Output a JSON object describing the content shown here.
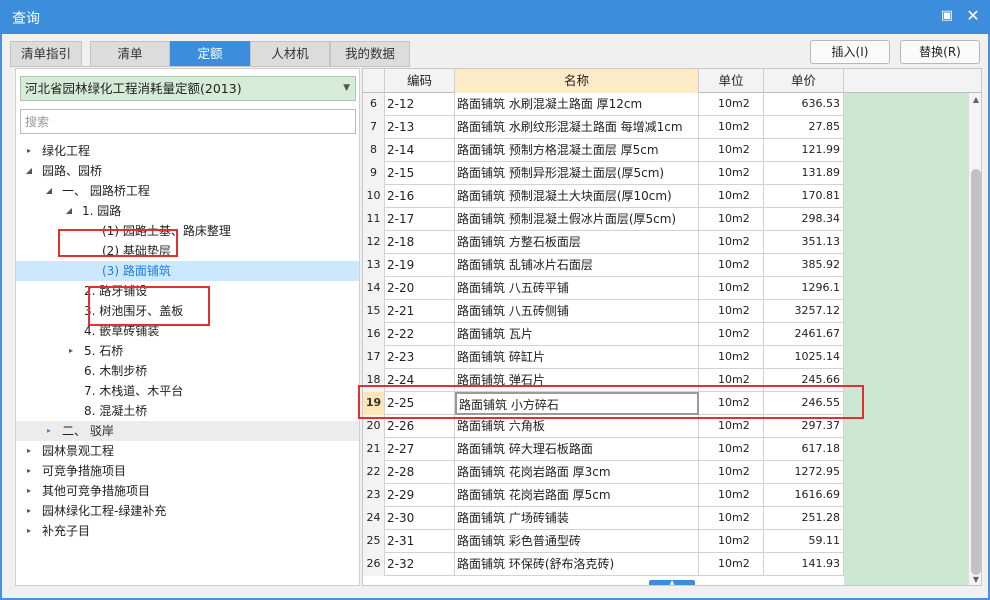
{
  "window": {
    "title": "查询",
    "maximize_icon": "maximize-icon",
    "close_icon": "close-icon"
  },
  "tabs": [
    {
      "label": "清单指引",
      "active": false
    },
    {
      "label": "清单",
      "active": false
    },
    {
      "label": "定额",
      "active": true
    },
    {
      "label": "人材机",
      "active": false
    },
    {
      "label": "我的数据",
      "active": false
    }
  ],
  "toolbar": {
    "insert_label": "插入(I)",
    "replace_label": "替换(R)"
  },
  "library": {
    "selected": "河北省园林绿化工程消耗量定额(2013)"
  },
  "search": {
    "placeholder": "搜索"
  },
  "tree": [
    {
      "label": "绿化工程",
      "expander": "▸"
    },
    {
      "label": "园路、园桥",
      "expander": "◢"
    },
    {
      "label": "一、 园路桥工程",
      "expander": "◢"
    },
    {
      "label": "1. 园路",
      "expander": "◢"
    },
    {
      "label": "(1) 园路土基、路床整理",
      "expander": ""
    },
    {
      "label": "(2) 基础垫层",
      "expander": ""
    },
    {
      "label": "(3) 路面铺筑",
      "expander": ""
    },
    {
      "label": "2. 路牙铺设",
      "expander": ""
    },
    {
      "label": "3. 树池围牙、盖板",
      "expander": ""
    },
    {
      "label": "4. 嵌草砖铺装",
      "expander": ""
    },
    {
      "label": "5. 石桥",
      "expander": "▸"
    },
    {
      "label": "6. 木制步桥",
      "expander": ""
    },
    {
      "label": "7. 木栈道、木平台",
      "expander": ""
    },
    {
      "label": "8. 混凝土桥",
      "expander": ""
    },
    {
      "label": "二、 驳岸",
      "expander": "▸"
    },
    {
      "label": "园林景观工程",
      "expander": "▸"
    },
    {
      "label": "可竞争措施项目",
      "expander": "▸"
    },
    {
      "label": "其他可竞争措施项目",
      "expander": "▸"
    },
    {
      "label": "园林绿化工程-绿建补充",
      "expander": "▸"
    },
    {
      "label": "补充子目",
      "expander": "▸"
    }
  ],
  "grid": {
    "headers": {
      "code": "编码",
      "name": "名称",
      "unit": "单位",
      "price": "单价"
    },
    "rows": [
      {
        "no": "6",
        "code": "2-12",
        "name": "路面铺筑 水刷混凝土路面 厚12cm",
        "unit": "10m2",
        "price": "636.53"
      },
      {
        "no": "7",
        "code": "2-13",
        "name": "路面铺筑 水刷纹形混凝土路面 每增减1cm",
        "unit": "10m2",
        "price": "27.85"
      },
      {
        "no": "8",
        "code": "2-14",
        "name": "路面铺筑 预制方格混凝土面层 厚5cm",
        "unit": "10m2",
        "price": "121.99"
      },
      {
        "no": "9",
        "code": "2-15",
        "name": "路面铺筑 预制异形混凝土面层(厚5cm)",
        "unit": "10m2",
        "price": "131.89"
      },
      {
        "no": "10",
        "code": "2-16",
        "name": "路面铺筑 预制混凝土大块面层(厚10cm)",
        "unit": "10m2",
        "price": "170.81"
      },
      {
        "no": "11",
        "code": "2-17",
        "name": "路面铺筑 预制混凝土假冰片面层(厚5cm)",
        "unit": "10m2",
        "price": "298.34"
      },
      {
        "no": "12",
        "code": "2-18",
        "name": "路面铺筑 方整石板面层",
        "unit": "10m2",
        "price": "351.13"
      },
      {
        "no": "13",
        "code": "2-19",
        "name": "路面铺筑 乱铺冰片石面层",
        "unit": "10m2",
        "price": "385.92"
      },
      {
        "no": "14",
        "code": "2-20",
        "name": "路面铺筑 八五砖平铺",
        "unit": "10m2",
        "price": "1296.1"
      },
      {
        "no": "15",
        "code": "2-21",
        "name": "路面铺筑 八五砖侧铺",
        "unit": "10m2",
        "price": "3257.12"
      },
      {
        "no": "16",
        "code": "2-22",
        "name": "路面铺筑 瓦片",
        "unit": "10m2",
        "price": "2461.67"
      },
      {
        "no": "17",
        "code": "2-23",
        "name": "路面铺筑 碎缸片",
        "unit": "10m2",
        "price": "1025.14"
      },
      {
        "no": "18",
        "code": "2-24",
        "name": "路面铺筑 弹石片",
        "unit": "10m2",
        "price": "245.66"
      },
      {
        "no": "19",
        "code": "2-25",
        "name": "路面铺筑 小方碎石",
        "unit": "10m2",
        "price": "246.55"
      },
      {
        "no": "20",
        "code": "2-26",
        "name": "路面铺筑 六角板",
        "unit": "10m2",
        "price": "297.37"
      },
      {
        "no": "21",
        "code": "2-27",
        "name": "路面铺筑 碎大理石板路面",
        "unit": "10m2",
        "price": "617.18"
      },
      {
        "no": "22",
        "code": "2-28",
        "name": "路面铺筑 花岗岩路面 厚3cm",
        "unit": "10m2",
        "price": "1272.95"
      },
      {
        "no": "23",
        "code": "2-29",
        "name": "路面铺筑 花岗岩路面 厚5cm",
        "unit": "10m2",
        "price": "1616.69"
      },
      {
        "no": "24",
        "code": "2-30",
        "name": "路面铺筑 广场砖铺装",
        "unit": "10m2",
        "price": "251.28"
      },
      {
        "no": "25",
        "code": "2-31",
        "name": "路面铺筑 彩色普通型砖",
        "unit": "10m2",
        "price": "59.11"
      },
      {
        "no": "26",
        "code": "2-32",
        "name": "路面铺筑 环保砖(舒布洛克砖)",
        "unit": "10m2",
        "price": "141.93"
      }
    ]
  },
  "colors": {
    "accent": "#3c8ddc",
    "selected_tree": "#cce8ff",
    "price_column": "#cde8d2",
    "highlight_box": "#e03030"
  },
  "icons": {
    "scroll_up": "▲",
    "scroll_down": "▼",
    "scroll_handle": "▲"
  }
}
